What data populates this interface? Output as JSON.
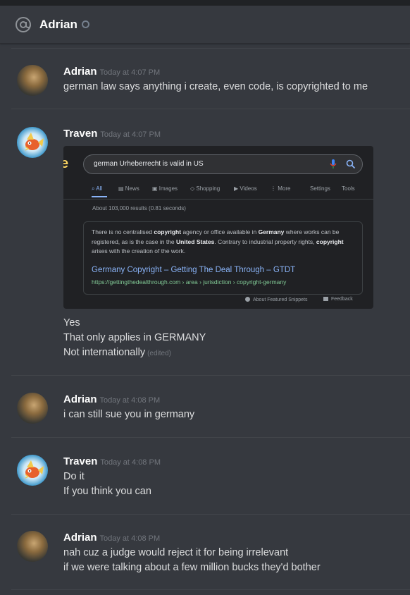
{
  "header": {
    "title": "Adrian"
  },
  "icons": {
    "at": "at-icon",
    "status": "offline-status-icon",
    "mic": "microphone-icon",
    "search": "search-icon"
  },
  "colors": {
    "background": "#36393f",
    "text": "#dcddde",
    "username": "#ffffff",
    "timestamp": "#72767d",
    "link": "#8ab4f8",
    "url_green": "#81c995"
  },
  "messages": [
    {
      "author": "Adrian",
      "time": "Today at 4:07 PM",
      "lines": [
        "german law says anything i create, even code, is copyrighted to me"
      ]
    },
    {
      "author": "Traven",
      "time": "Today at 4:07 PM",
      "lines": [
        "Yes",
        "That only applies in GERMANY",
        "Not internationally"
      ],
      "edited": "(edited)"
    },
    {
      "author": "Adrian",
      "time": "Today at 4:08 PM",
      "lines": [
        "i can still sue you in germany"
      ]
    },
    {
      "author": "Traven",
      "time": "Today at 4:08 PM",
      "lines": [
        "Do it",
        "If you think you can"
      ]
    },
    {
      "author": "Adrian",
      "time": "Today at 4:08 PM",
      "lines": [
        "nah cuz a judge would reject it for being irrelevant",
        "if we were talking about a few million bucks they'd bother"
      ]
    }
  ],
  "embed": {
    "logo_letter": "e",
    "query": "german Urheberrecht is valid in US",
    "tabs": [
      "All",
      "News",
      "Images",
      "Shopping",
      "Videos",
      "More",
      "Settings",
      "Tools"
    ],
    "stats": "About 103,000 results (0.81 seconds)",
    "snippet": {
      "p1": "There is no centralised ",
      "b1": "copyright",
      "p2": " agency or office available in ",
      "b2": "Germany",
      "p3": " where works can be registered, as is the case in the ",
      "b3": "United States",
      "p4": ". Contrary to industrial property rights, ",
      "b4": "copyright",
      "p5": " arises with the creation of the work."
    },
    "result_title": "Germany Copyright – Getting The Deal Through – GTDT",
    "result_url": "https://gettingthedealthrough.com › area › jurisdiction › copyright-germany",
    "footer_about": "About Featured Snippets",
    "footer_feedback": "Feedback"
  }
}
